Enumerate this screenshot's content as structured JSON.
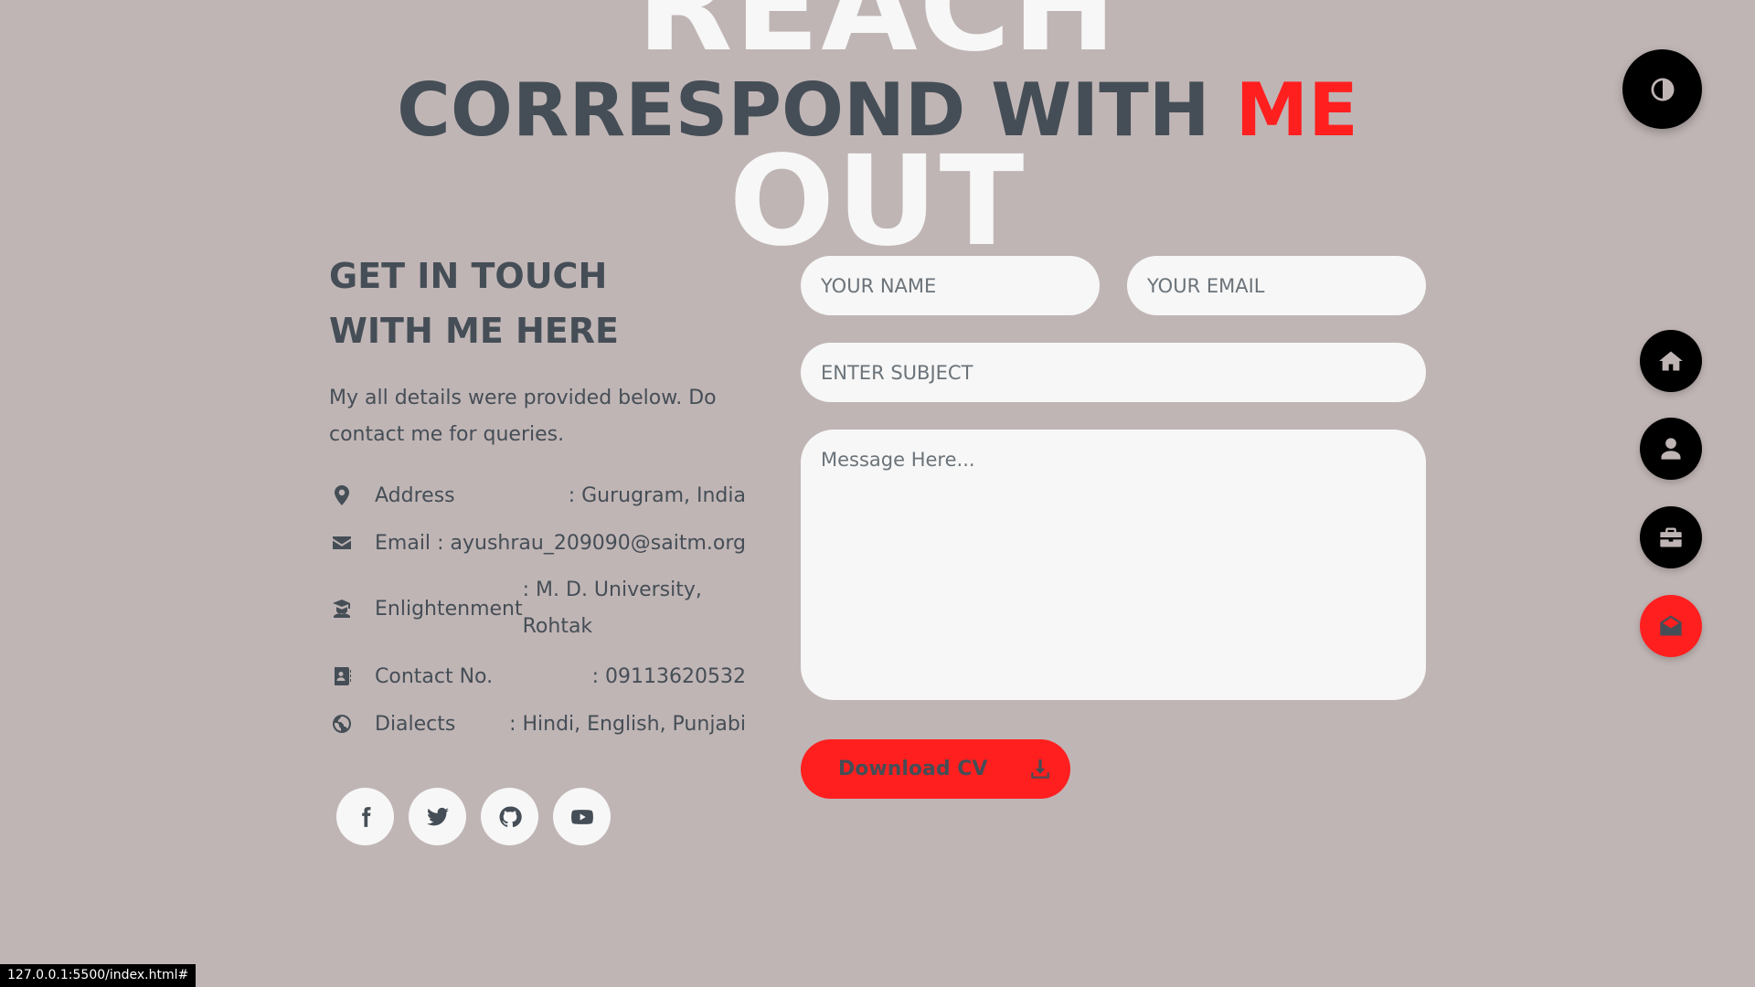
{
  "heading": {
    "bg_top": "REACH",
    "bg_bottom": "OUT",
    "title_main": "CORRESPOND WITH",
    "title_accent": "ME"
  },
  "contact": {
    "title": "GET IN TOUCH WITH ME HERE",
    "description": "My all details were provided below. Do contact me for queries.",
    "items": [
      {
        "icon": "location-pin-icon",
        "label": "Address",
        "value": ": Gurugram, India"
      },
      {
        "icon": "envelope-icon",
        "label": "Email",
        "value": ": ayushrau_209090@saitm.org"
      },
      {
        "icon": "graduate-icon",
        "label": "Enlightenment",
        "value": ": M. D. University, Rohtak"
      },
      {
        "icon": "address-book-icon",
        "label": "Contact No.",
        "value": ": 09113620532"
      },
      {
        "icon": "globe-icon",
        "label": "Dialects",
        "value": ": Hindi, English, Punjabi"
      }
    ]
  },
  "socials": [
    "facebook-icon",
    "twitter-icon",
    "github-icon",
    "youtube-icon"
  ],
  "form": {
    "name_placeholder": "YOUR NAME",
    "email_placeholder": "YOUR EMAIL",
    "subject_placeholder": "ENTER SUBJECT",
    "message_placeholder": "Message Here...",
    "cv_button": "Download CV"
  },
  "nav": {
    "theme_icon": "contrast-icon",
    "items": [
      "home-icon",
      "user-icon",
      "briefcase-icon",
      "envelope-open-icon"
    ],
    "active": "envelope-open-icon"
  },
  "status_bar": {
    "url": "127.0.0.1:5500/index.html#"
  },
  "colors": {
    "background": "#c0b5b5",
    "accent": "#ff1f1f",
    "text": "#454e56",
    "light": "#f7f7f7"
  }
}
